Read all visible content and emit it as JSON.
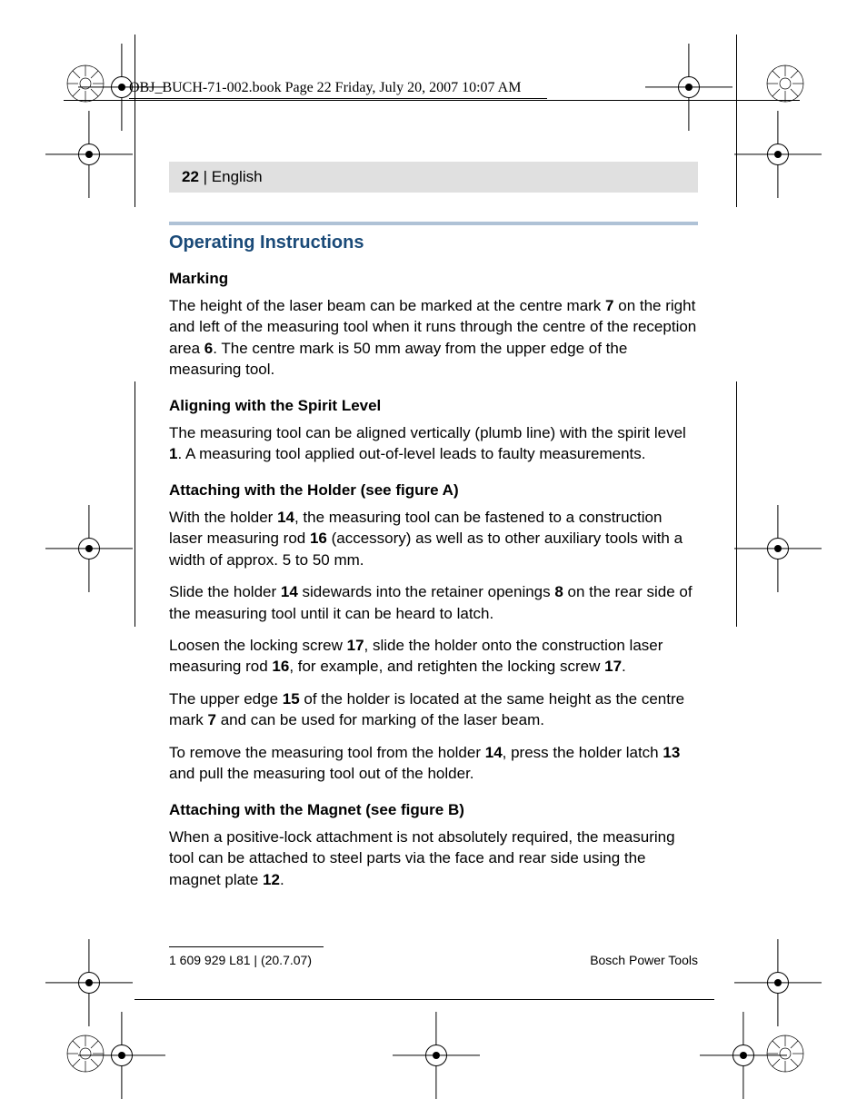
{
  "bookinfo": "OBJ_BUCH-71-002.book  Page 22  Friday, July 20, 2007  10:07 AM",
  "header": {
    "page_number": "22",
    "separator": " | ",
    "language": "English"
  },
  "section_title": "Operating Instructions",
  "sections": [
    {
      "heading": "Marking",
      "paragraphs": [
        "The height of the laser beam can be marked at the centre mark <b>7</b> on the right and left of the measuring tool when it runs through the centre of the reception area <b>6</b>. The centre mark is 50 mm away from the upper edge of the measuring tool."
      ]
    },
    {
      "heading": "Aligning with the Spirit Level",
      "paragraphs": [
        "The measuring tool can be aligned vertically (plumb line) with the spirit level <b>1</b>. A measuring tool applied out-of-level leads to faulty measurements."
      ]
    },
    {
      "heading": "Attaching with the Holder (see figure A)",
      "paragraphs": [
        "With the holder <b>14</b>, the measuring tool can be fastened to a construction laser measuring rod <b>16</b> (accessory) as well as to other auxiliary tools with a width of approx. 5 to 50 mm.",
        "Slide the holder <b>14</b> sidewards into the retainer openings <b>8</b> on the rear side of the measuring tool until it can be heard to latch.",
        "Loosen the locking screw <b>17</b>, slide the holder onto the construction laser measuring rod <b>16</b>, for example, and retighten the locking screw <b>17</b>.",
        "The upper edge <b>15</b> of the holder is located at the same height as the centre mark <b>7</b> and can be used for marking of the laser beam.",
        "To remove the measuring tool from the holder <b>14</b>, press the holder latch <b>13</b> and pull the measuring tool out of the holder."
      ]
    },
    {
      "heading": "Attaching with the Magnet (see figure B)",
      "paragraphs": [
        "When a positive-lock attachment is not absolutely required, the measuring tool can be attached to steel parts via the face and rear side using the magnet plate <b>12</b>."
      ]
    }
  ],
  "footer": {
    "left": "1 609 929 L81 | (20.7.07)",
    "right": "Bosch Power Tools"
  }
}
